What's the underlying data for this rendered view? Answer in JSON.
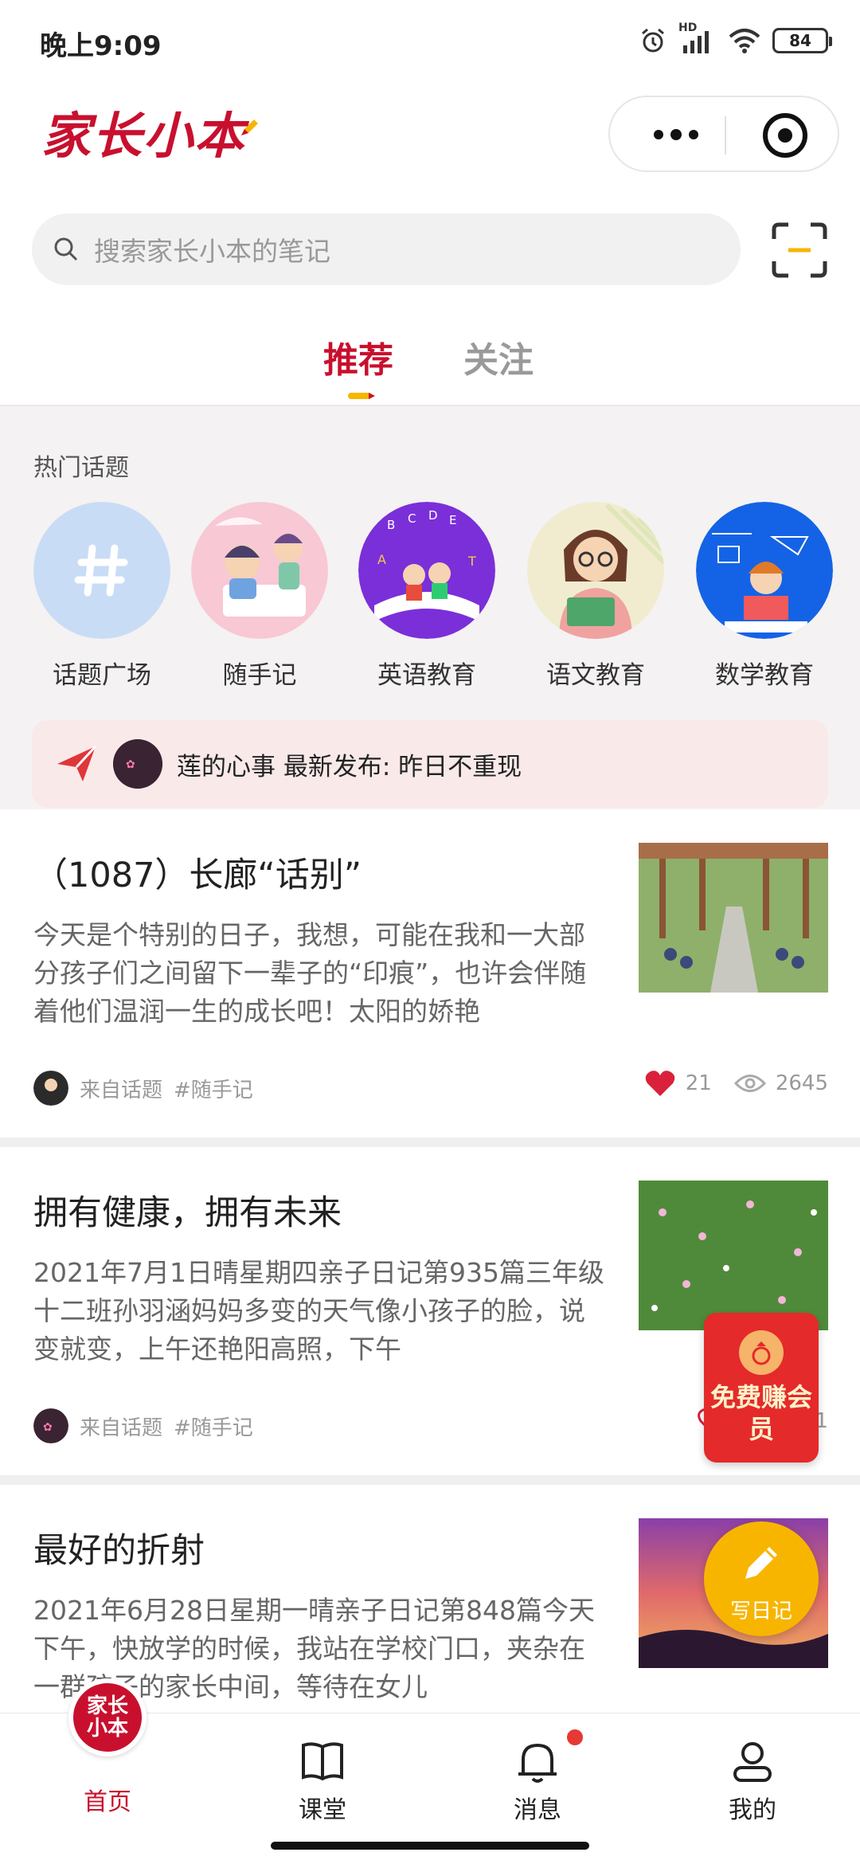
{
  "status_bar": {
    "time": "晚上9:09",
    "battery": "84",
    "network": "HD"
  },
  "header": {
    "logo_text": "家长小本"
  },
  "search": {
    "placeholder": "搜索家长小本的笔记"
  },
  "tabs": [
    {
      "label": "推荐",
      "active": true
    },
    {
      "label": "关注",
      "active": false
    }
  ],
  "hot_topics": {
    "title": "热门话题",
    "items": [
      {
        "label": "话题广场",
        "icon": "hash-icon"
      },
      {
        "label": "随手记",
        "icon": "kids-writing-illustration"
      },
      {
        "label": "英语教育",
        "icon": "english-book-illustration"
      },
      {
        "label": "语文教育",
        "icon": "chinese-reading-illustration"
      },
      {
        "label": "数学教育",
        "icon": "math-study-illustration"
      }
    ]
  },
  "notice": {
    "text": "莲的心事 最新发布: 昨日不重现"
  },
  "posts": [
    {
      "title": "（1087）长廊“话别”",
      "excerpt": "今天是个特别的日子，我想，可能在我和一大部分孩子们之间留下一辈子的“印痕”，也许会伴随着他们温润一生的成长吧！太阳的娇艳",
      "from": "来自话题",
      "tag": "#随手记",
      "likes": "21",
      "views": "2645",
      "liked": true
    },
    {
      "title": "拥有健康，拥有未来",
      "excerpt": "2021年7月1日晴星期四亲子日记第935篇三年级十二班孙羽涵妈妈多变的天气像小孩子的脸，说变就变，上午还艳阳高照，下午",
      "from": "来自话题",
      "tag": "#随手记",
      "likes": "1",
      "views": "1",
      "liked": false
    },
    {
      "title": "最好的折射",
      "excerpt": "2021年6月28日星期一晴亲子日记第848篇今天下午，快放学的时候，我站在学校门口，夹杂在一群孩子的家长中间，等待在女儿"
    }
  ],
  "floating": {
    "vip_text": "免费赚会员",
    "write_text": "写日记"
  },
  "bottom_nav": [
    {
      "label": "首页",
      "icon": "home-logo-icon",
      "active": true,
      "badge_text": "家长小本"
    },
    {
      "label": "课堂",
      "icon": "book-icon"
    },
    {
      "label": "消息",
      "icon": "bell-icon",
      "dot": true
    },
    {
      "label": "我的",
      "icon": "user-icon"
    }
  ],
  "colors": {
    "brand": "#c8102e",
    "accent": "#f7b500",
    "vip": "#e42a2a"
  }
}
